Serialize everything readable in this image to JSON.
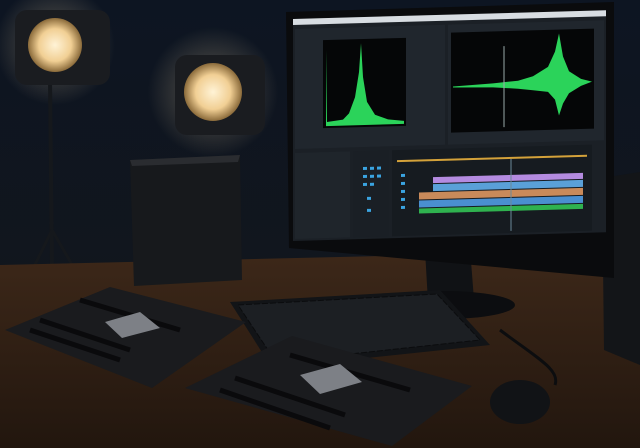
{
  "scene": {
    "description_tags": [],
    "colors": {
      "wall": "#0e1826",
      "desk": "#3a2518",
      "lamp_glow": "#f6dcaa",
      "waveform": "#2bd35a",
      "track_purple": "#b48be0",
      "track_blue": "#5aa0d8",
      "track_orange": "#c98a5a",
      "track_green": "#2fb24f",
      "playhead_bar": "#d4a23a"
    }
  }
}
